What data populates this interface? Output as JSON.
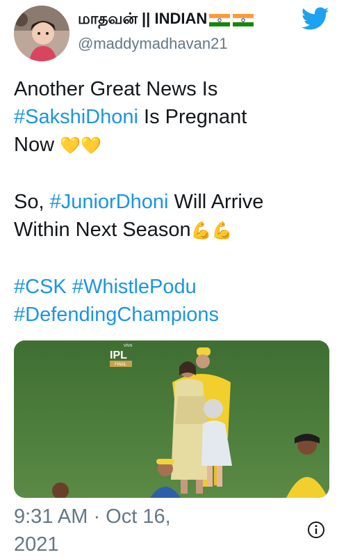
{
  "author": {
    "display_name": "மாதவன் || INDIAN",
    "handle": "@maddymadhavan21",
    "avatar_icon": "avatar-photo",
    "flag_icons": [
      "india-flag-icon",
      "india-flag-icon"
    ]
  },
  "tweet": {
    "line1": "Another Great News Is",
    "line2_hashtag": "#SakshiDhoni",
    "line2_text": " Is Pregnant",
    "line3_text": "Now ",
    "line3_emoji": "💛💛",
    "line4_text_a": "So, ",
    "line4_hashtag": "#JuniorDhoni",
    "line4_text_b": " Will Arrive",
    "line5_text": "Within Next Season",
    "line5_emoji": "💪💪",
    "hashtag_csk": "#CSK",
    "hashtag_whistle": "#WhistlePodu",
    "hashtag_defending": "#DefendingChampions"
  },
  "media": {
    "logo_top": "vivo",
    "logo_main": "IPL",
    "logo_sub": "FINAL"
  },
  "footer": {
    "timestamp": "9:31 AM · Oct 16, 2021",
    "info_icon": "info-icon"
  },
  "colors": {
    "hashtag": "#1b95e0",
    "secondary": "#657786",
    "twitter_blue": "#1da1f2",
    "pitch": "#4c7a3d"
  }
}
